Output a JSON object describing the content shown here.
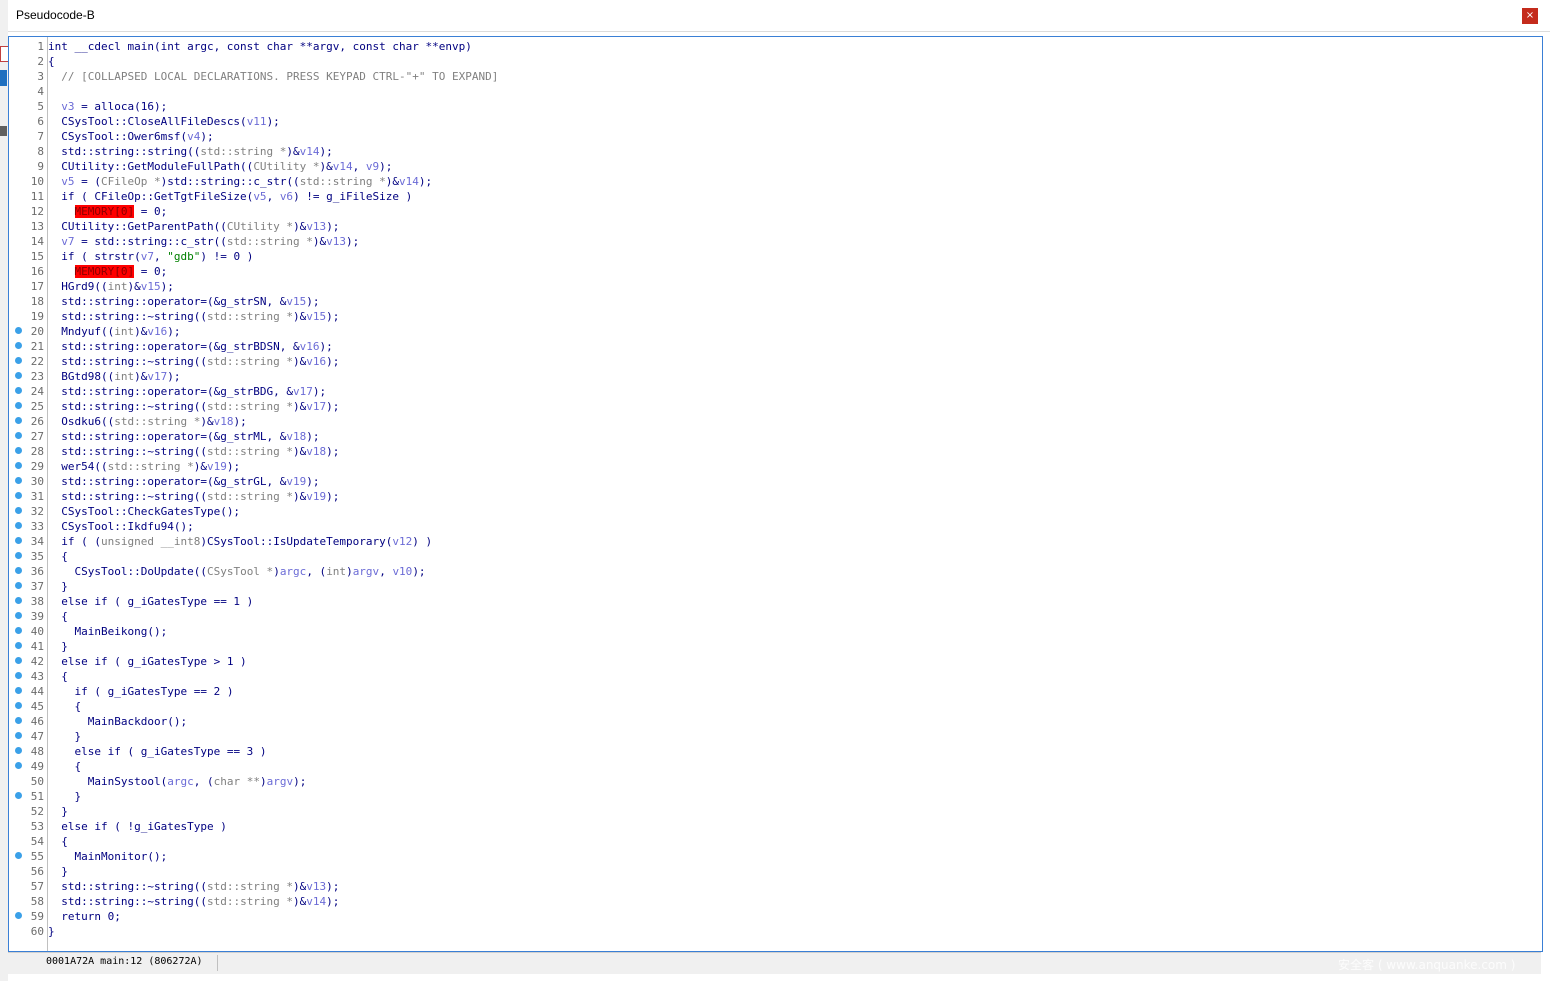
{
  "window": {
    "title": "Pseudocode-B",
    "close_label": "×"
  },
  "status": {
    "text": "0001A72A main:12 (806272A)",
    "watermark": "安全客 ( www.anquanke.com )"
  },
  "code": {
    "lines": [
      {
        "n": "1",
        "bp": false,
        "indent": 0,
        "tokens": [
          [
            "t",
            "int __cdecl main(int argc, const char **argv, const char **envp)"
          ]
        ]
      },
      {
        "n": "2",
        "bp": false,
        "indent": 0,
        "tokens": [
          [
            "t",
            "{"
          ]
        ]
      },
      {
        "n": "3",
        "bp": false,
        "indent": 2,
        "tokens": [
          [
            "c",
            "// [COLLAPSED LOCAL DECLARATIONS. PRESS KEYPAD CTRL-\"+\" TO EXPAND]"
          ]
        ]
      },
      {
        "n": "4",
        "bp": false,
        "indent": 0,
        "tokens": []
      },
      {
        "n": "5",
        "bp": false,
        "indent": 2,
        "tokens": [
          [
            "l",
            "v3"
          ],
          [
            "t",
            " = alloca(16);"
          ]
        ]
      },
      {
        "n": "6",
        "bp": false,
        "indent": 2,
        "tokens": [
          [
            "t",
            "CSysTool::CloseAllFileDescs("
          ],
          [
            "l",
            "v11"
          ],
          [
            "t",
            ");"
          ]
        ]
      },
      {
        "n": "7",
        "bp": false,
        "indent": 2,
        "tokens": [
          [
            "t",
            "CSysTool::Ower6msf("
          ],
          [
            "l",
            "v4"
          ],
          [
            "t",
            ");"
          ]
        ]
      },
      {
        "n": "8",
        "bp": false,
        "indent": 2,
        "tokens": [
          [
            "t",
            "std::string::string(("
          ],
          [
            "g",
            "std::string *"
          ],
          [
            "t",
            ")&"
          ],
          [
            "l",
            "v14"
          ],
          [
            "t",
            ");"
          ]
        ]
      },
      {
        "n": "9",
        "bp": false,
        "indent": 2,
        "tokens": [
          [
            "t",
            "CUtility::GetModuleFullPath(("
          ],
          [
            "g",
            "CUtility *"
          ],
          [
            "t",
            ")&"
          ],
          [
            "l",
            "v14"
          ],
          [
            "t",
            ", "
          ],
          [
            "l",
            "v9"
          ],
          [
            "t",
            ");"
          ]
        ]
      },
      {
        "n": "10",
        "bp": false,
        "indent": 2,
        "tokens": [
          [
            "l",
            "v5"
          ],
          [
            "t",
            " = ("
          ],
          [
            "g",
            "CFileOp *"
          ],
          [
            "t",
            ")std::string::c_str(("
          ],
          [
            "g",
            "std::string *"
          ],
          [
            "t",
            ")&"
          ],
          [
            "l",
            "v14"
          ],
          [
            "t",
            ");"
          ]
        ]
      },
      {
        "n": "11",
        "bp": false,
        "indent": 2,
        "tokens": [
          [
            "t",
            "if ( CFileOp::GetTgtFileSize("
          ],
          [
            "l",
            "v5"
          ],
          [
            "t",
            ", "
          ],
          [
            "l",
            "v6"
          ],
          [
            "t",
            ") != g_iFileSize )"
          ]
        ]
      },
      {
        "n": "12",
        "bp": false,
        "indent": 4,
        "tokens": [
          [
            "m",
            "MEMORY[0]"
          ],
          [
            "t",
            " = 0;"
          ]
        ]
      },
      {
        "n": "13",
        "bp": false,
        "indent": 2,
        "tokens": [
          [
            "t",
            "CUtility::GetParentPath(("
          ],
          [
            "g",
            "CUtility *"
          ],
          [
            "t",
            ")&"
          ],
          [
            "l",
            "v13"
          ],
          [
            "t",
            ");"
          ]
        ]
      },
      {
        "n": "14",
        "bp": false,
        "indent": 2,
        "tokens": [
          [
            "l",
            "v7"
          ],
          [
            "t",
            " = std::string::c_str(("
          ],
          [
            "g",
            "std::string *"
          ],
          [
            "t",
            ")&"
          ],
          [
            "l",
            "v13"
          ],
          [
            "t",
            ");"
          ]
        ]
      },
      {
        "n": "15",
        "bp": false,
        "indent": 2,
        "tokens": [
          [
            "t",
            "if ( strstr("
          ],
          [
            "l",
            "v7"
          ],
          [
            "t",
            ", "
          ],
          [
            "s",
            "\"gdb\""
          ],
          [
            "t",
            ") != 0 )"
          ]
        ]
      },
      {
        "n": "16",
        "bp": false,
        "indent": 4,
        "tokens": [
          [
            "m",
            "MEMORY[0]"
          ],
          [
            "t",
            " = 0;"
          ]
        ]
      },
      {
        "n": "17",
        "bp": false,
        "indent": 2,
        "tokens": [
          [
            "t",
            "HGrd9(("
          ],
          [
            "g",
            "int"
          ],
          [
            "t",
            ")&"
          ],
          [
            "l",
            "v15"
          ],
          [
            "t",
            ");"
          ]
        ]
      },
      {
        "n": "18",
        "bp": false,
        "indent": 2,
        "tokens": [
          [
            "t",
            "std::string::operator=(&g_strSN, &"
          ],
          [
            "l",
            "v15"
          ],
          [
            "t",
            ");"
          ]
        ]
      },
      {
        "n": "19",
        "bp": false,
        "indent": 2,
        "tokens": [
          [
            "t",
            "std::string::~string(("
          ],
          [
            "g",
            "std::string *"
          ],
          [
            "t",
            ")&"
          ],
          [
            "l",
            "v15"
          ],
          [
            "t",
            ");"
          ]
        ]
      },
      {
        "n": "20",
        "bp": true,
        "indent": 2,
        "tokens": [
          [
            "t",
            "Mndyuf(("
          ],
          [
            "g",
            "int"
          ],
          [
            "t",
            ")&"
          ],
          [
            "l",
            "v16"
          ],
          [
            "t",
            ");"
          ]
        ]
      },
      {
        "n": "21",
        "bp": true,
        "indent": 2,
        "tokens": [
          [
            "t",
            "std::string::operator=(&g_strBDSN, &"
          ],
          [
            "l",
            "v16"
          ],
          [
            "t",
            ");"
          ]
        ]
      },
      {
        "n": "22",
        "bp": true,
        "indent": 2,
        "tokens": [
          [
            "t",
            "std::string::~string(("
          ],
          [
            "g",
            "std::string *"
          ],
          [
            "t",
            ")&"
          ],
          [
            "l",
            "v16"
          ],
          [
            "t",
            ");"
          ]
        ]
      },
      {
        "n": "23",
        "bp": true,
        "indent": 2,
        "tokens": [
          [
            "t",
            "BGtd98(("
          ],
          [
            "g",
            "int"
          ],
          [
            "t",
            ")&"
          ],
          [
            "l",
            "v17"
          ],
          [
            "t",
            ");"
          ]
        ]
      },
      {
        "n": "24",
        "bp": true,
        "indent": 2,
        "tokens": [
          [
            "t",
            "std::string::operator=(&g_strBDG, &"
          ],
          [
            "l",
            "v17"
          ],
          [
            "t",
            ");"
          ]
        ]
      },
      {
        "n": "25",
        "bp": true,
        "indent": 2,
        "tokens": [
          [
            "t",
            "std::string::~string(("
          ],
          [
            "g",
            "std::string *"
          ],
          [
            "t",
            ")&"
          ],
          [
            "l",
            "v17"
          ],
          [
            "t",
            ");"
          ]
        ]
      },
      {
        "n": "26",
        "bp": true,
        "indent": 2,
        "tokens": [
          [
            "t",
            "Osdku6(("
          ],
          [
            "g",
            "std::string *"
          ],
          [
            "t",
            ")&"
          ],
          [
            "l",
            "v18"
          ],
          [
            "t",
            ");"
          ]
        ]
      },
      {
        "n": "27",
        "bp": true,
        "indent": 2,
        "tokens": [
          [
            "t",
            "std::string::operator=(&g_strML, &"
          ],
          [
            "l",
            "v18"
          ],
          [
            "t",
            ");"
          ]
        ]
      },
      {
        "n": "28",
        "bp": true,
        "indent": 2,
        "tokens": [
          [
            "t",
            "std::string::~string(("
          ],
          [
            "g",
            "std::string *"
          ],
          [
            "t",
            ")&"
          ],
          [
            "l",
            "v18"
          ],
          [
            "t",
            ");"
          ]
        ]
      },
      {
        "n": "29",
        "bp": true,
        "indent": 2,
        "tokens": [
          [
            "t",
            "wer54(("
          ],
          [
            "g",
            "std::string *"
          ],
          [
            "t",
            ")&"
          ],
          [
            "l",
            "v19"
          ],
          [
            "t",
            ");"
          ]
        ]
      },
      {
        "n": "30",
        "bp": true,
        "indent": 2,
        "tokens": [
          [
            "t",
            "std::string::operator=(&g_strGL, &"
          ],
          [
            "l",
            "v19"
          ],
          [
            "t",
            ");"
          ]
        ]
      },
      {
        "n": "31",
        "bp": true,
        "indent": 2,
        "tokens": [
          [
            "t",
            "std::string::~string(("
          ],
          [
            "g",
            "std::string *"
          ],
          [
            "t",
            ")&"
          ],
          [
            "l",
            "v19"
          ],
          [
            "t",
            ");"
          ]
        ]
      },
      {
        "n": "32",
        "bp": true,
        "indent": 2,
        "tokens": [
          [
            "t",
            "CSysTool::CheckGatesType();"
          ]
        ]
      },
      {
        "n": "33",
        "bp": true,
        "indent": 2,
        "tokens": [
          [
            "t",
            "CSysTool::Ikdfu94();"
          ]
        ]
      },
      {
        "n": "34",
        "bp": true,
        "indent": 2,
        "tokens": [
          [
            "t",
            "if ( ("
          ],
          [
            "g",
            "unsigned __int8"
          ],
          [
            "t",
            ")CSysTool::IsUpdateTemporary("
          ],
          [
            "l",
            "v12"
          ],
          [
            "t",
            ") )"
          ]
        ]
      },
      {
        "n": "35",
        "bp": true,
        "indent": 2,
        "tokens": [
          [
            "t",
            "{"
          ]
        ]
      },
      {
        "n": "36",
        "bp": true,
        "indent": 4,
        "tokens": [
          [
            "t",
            "CSysTool::DoUpdate(("
          ],
          [
            "g",
            "CSysTool *"
          ],
          [
            "t",
            ")"
          ],
          [
            "l",
            "argc"
          ],
          [
            "t",
            ", ("
          ],
          [
            "g",
            "int"
          ],
          [
            "t",
            ")"
          ],
          [
            "l",
            "argv"
          ],
          [
            "t",
            ", "
          ],
          [
            "l",
            "v10"
          ],
          [
            "t",
            ");"
          ]
        ]
      },
      {
        "n": "37",
        "bp": true,
        "indent": 2,
        "tokens": [
          [
            "t",
            "}"
          ]
        ]
      },
      {
        "n": "38",
        "bp": true,
        "indent": 2,
        "tokens": [
          [
            "t",
            "else if ( g_iGatesType == 1 )"
          ]
        ]
      },
      {
        "n": "39",
        "bp": true,
        "indent": 2,
        "tokens": [
          [
            "t",
            "{"
          ]
        ]
      },
      {
        "n": "40",
        "bp": true,
        "indent": 4,
        "tokens": [
          [
            "t",
            "MainBeikong();"
          ]
        ]
      },
      {
        "n": "41",
        "bp": true,
        "indent": 2,
        "tokens": [
          [
            "t",
            "}"
          ]
        ]
      },
      {
        "n": "42",
        "bp": true,
        "indent": 2,
        "tokens": [
          [
            "t",
            "else if ( g_iGatesType > 1 )"
          ]
        ]
      },
      {
        "n": "43",
        "bp": true,
        "indent": 2,
        "tokens": [
          [
            "t",
            "{"
          ]
        ]
      },
      {
        "n": "44",
        "bp": true,
        "indent": 4,
        "tokens": [
          [
            "t",
            "if ( g_iGatesType == 2 )"
          ]
        ]
      },
      {
        "n": "45",
        "bp": true,
        "indent": 4,
        "tokens": [
          [
            "t",
            "{"
          ]
        ]
      },
      {
        "n": "46",
        "bp": true,
        "indent": 6,
        "tokens": [
          [
            "t",
            "MainBackdoor();"
          ]
        ]
      },
      {
        "n": "47",
        "bp": true,
        "indent": 4,
        "tokens": [
          [
            "t",
            "}"
          ]
        ]
      },
      {
        "n": "48",
        "bp": true,
        "indent": 4,
        "tokens": [
          [
            "t",
            "else if ( g_iGatesType == 3 )"
          ]
        ]
      },
      {
        "n": "49",
        "bp": true,
        "indent": 4,
        "tokens": [
          [
            "t",
            "{"
          ]
        ]
      },
      {
        "n": "50",
        "bp": false,
        "indent": 6,
        "tokens": [
          [
            "t",
            "MainSystool("
          ],
          [
            "l",
            "argc"
          ],
          [
            "t",
            ", ("
          ],
          [
            "g",
            "char **"
          ],
          [
            "t",
            ")"
          ],
          [
            "l",
            "argv"
          ],
          [
            "t",
            ");"
          ]
        ]
      },
      {
        "n": "51",
        "bp": true,
        "indent": 4,
        "tokens": [
          [
            "t",
            "}"
          ]
        ]
      },
      {
        "n": "52",
        "bp": false,
        "indent": 2,
        "tokens": [
          [
            "t",
            "}"
          ]
        ]
      },
      {
        "n": "53",
        "bp": false,
        "indent": 2,
        "tokens": [
          [
            "t",
            "else if ( !g_iGatesType )"
          ]
        ]
      },
      {
        "n": "54",
        "bp": false,
        "indent": 2,
        "tokens": [
          [
            "t",
            "{"
          ]
        ]
      },
      {
        "n": "55",
        "bp": true,
        "indent": 4,
        "tokens": [
          [
            "t",
            "MainMonitor();"
          ]
        ]
      },
      {
        "n": "56",
        "bp": false,
        "indent": 2,
        "tokens": [
          [
            "t",
            "}"
          ]
        ]
      },
      {
        "n": "57",
        "bp": false,
        "indent": 2,
        "tokens": [
          [
            "t",
            "std::string::~string(("
          ],
          [
            "g",
            "std::string *"
          ],
          [
            "t",
            ")&"
          ],
          [
            "l",
            "v13"
          ],
          [
            "t",
            ");"
          ]
        ]
      },
      {
        "n": "58",
        "bp": false,
        "indent": 2,
        "tokens": [
          [
            "t",
            "std::string::~string(("
          ],
          [
            "g",
            "std::string *"
          ],
          [
            "t",
            ")&"
          ],
          [
            "l",
            "v14"
          ],
          [
            "t",
            ");"
          ]
        ]
      },
      {
        "n": "59",
        "bp": true,
        "indent": 2,
        "tokens": [
          [
            "t",
            "return 0;"
          ]
        ]
      },
      {
        "n": "60",
        "bp": false,
        "indent": 0,
        "tokens": [
          [
            "t",
            "}"
          ]
        ]
      }
    ]
  },
  "background": {
    "right_chars": [
      "v",
      "[",
      "0",
      "[",
      "",
      "D",
      "1",
      "v",
      "0"
    ],
    "right_colors": [
      "#1a6fbf",
      "#1a1a8c",
      "#2e8b57",
      "#1a1a8c",
      "#000000",
      "#1a6fbf",
      "#2e8b57",
      "#2e8b57",
      "#1a6fbf"
    ]
  }
}
